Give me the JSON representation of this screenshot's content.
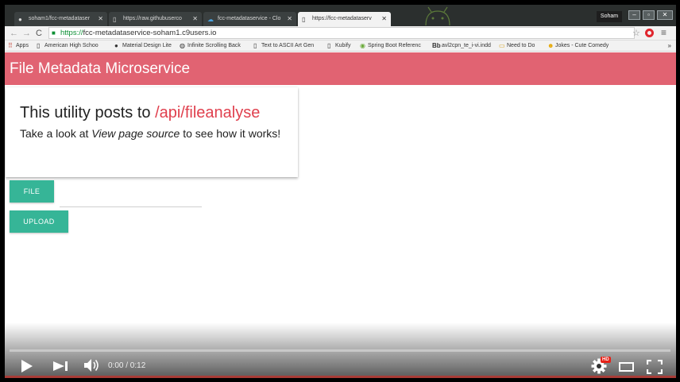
{
  "browser": {
    "tabs": [
      {
        "label": "soham1/fcc-metadataser",
        "favicon": "github-icon"
      },
      {
        "label": "https://raw.githubuserco",
        "favicon": "page-icon"
      },
      {
        "label": "fcc-metadataservice - Clo",
        "favicon": "cloud9-icon"
      },
      {
        "label": "https://fcc-metadataserv",
        "favicon": "page-icon"
      }
    ],
    "user": "Soham",
    "url_scheme": "https://",
    "url_rest": "fcc-metadataservice-soham1.c9users.io",
    "bookmarks": [
      {
        "label": "Apps",
        "icon": "apps-grid-icon"
      },
      {
        "label": "American High Schoo",
        "icon": "page-icon"
      },
      {
        "label": "Material Design Lite",
        "icon": "mdl-icon"
      },
      {
        "label": "Infinite Scrolling Back",
        "icon": "globe-icon"
      },
      {
        "label": "Text to ASCII Art Gen",
        "icon": "page-icon"
      },
      {
        "label": "Kubify",
        "icon": "page-icon"
      },
      {
        "label": "Spring Boot Referenc",
        "icon": "spring-icon"
      },
      {
        "label": "avl2cpn_te_i-vi.indd",
        "icon": "bb-icon"
      },
      {
        "label": "Need to Do",
        "icon": "folder-icon"
      },
      {
        "label": "Jokes - Cute Comedy",
        "icon": "smiley-icon"
      }
    ],
    "bookmarks_more": "»",
    "menu_glyph": "≡",
    "star_glyph": "☆"
  },
  "page": {
    "header_title": "File Metadata Microservice",
    "card_title_prefix": "This utility posts to ",
    "card_title_api": "/api/fileanalyse",
    "card_text_1": "Take a look at ",
    "card_text_em": "View page source",
    "card_text_2": " to see how it works!",
    "file_button": "FILE",
    "upload_button": "UPLOAD"
  },
  "video": {
    "time": "0:00 / 0:12",
    "progress": 0,
    "hd_badge": "HD"
  },
  "colors": {
    "header": "#e16372",
    "accent_text": "#e0404e",
    "button": "#36b597",
    "youtube_red": "#e62117"
  }
}
